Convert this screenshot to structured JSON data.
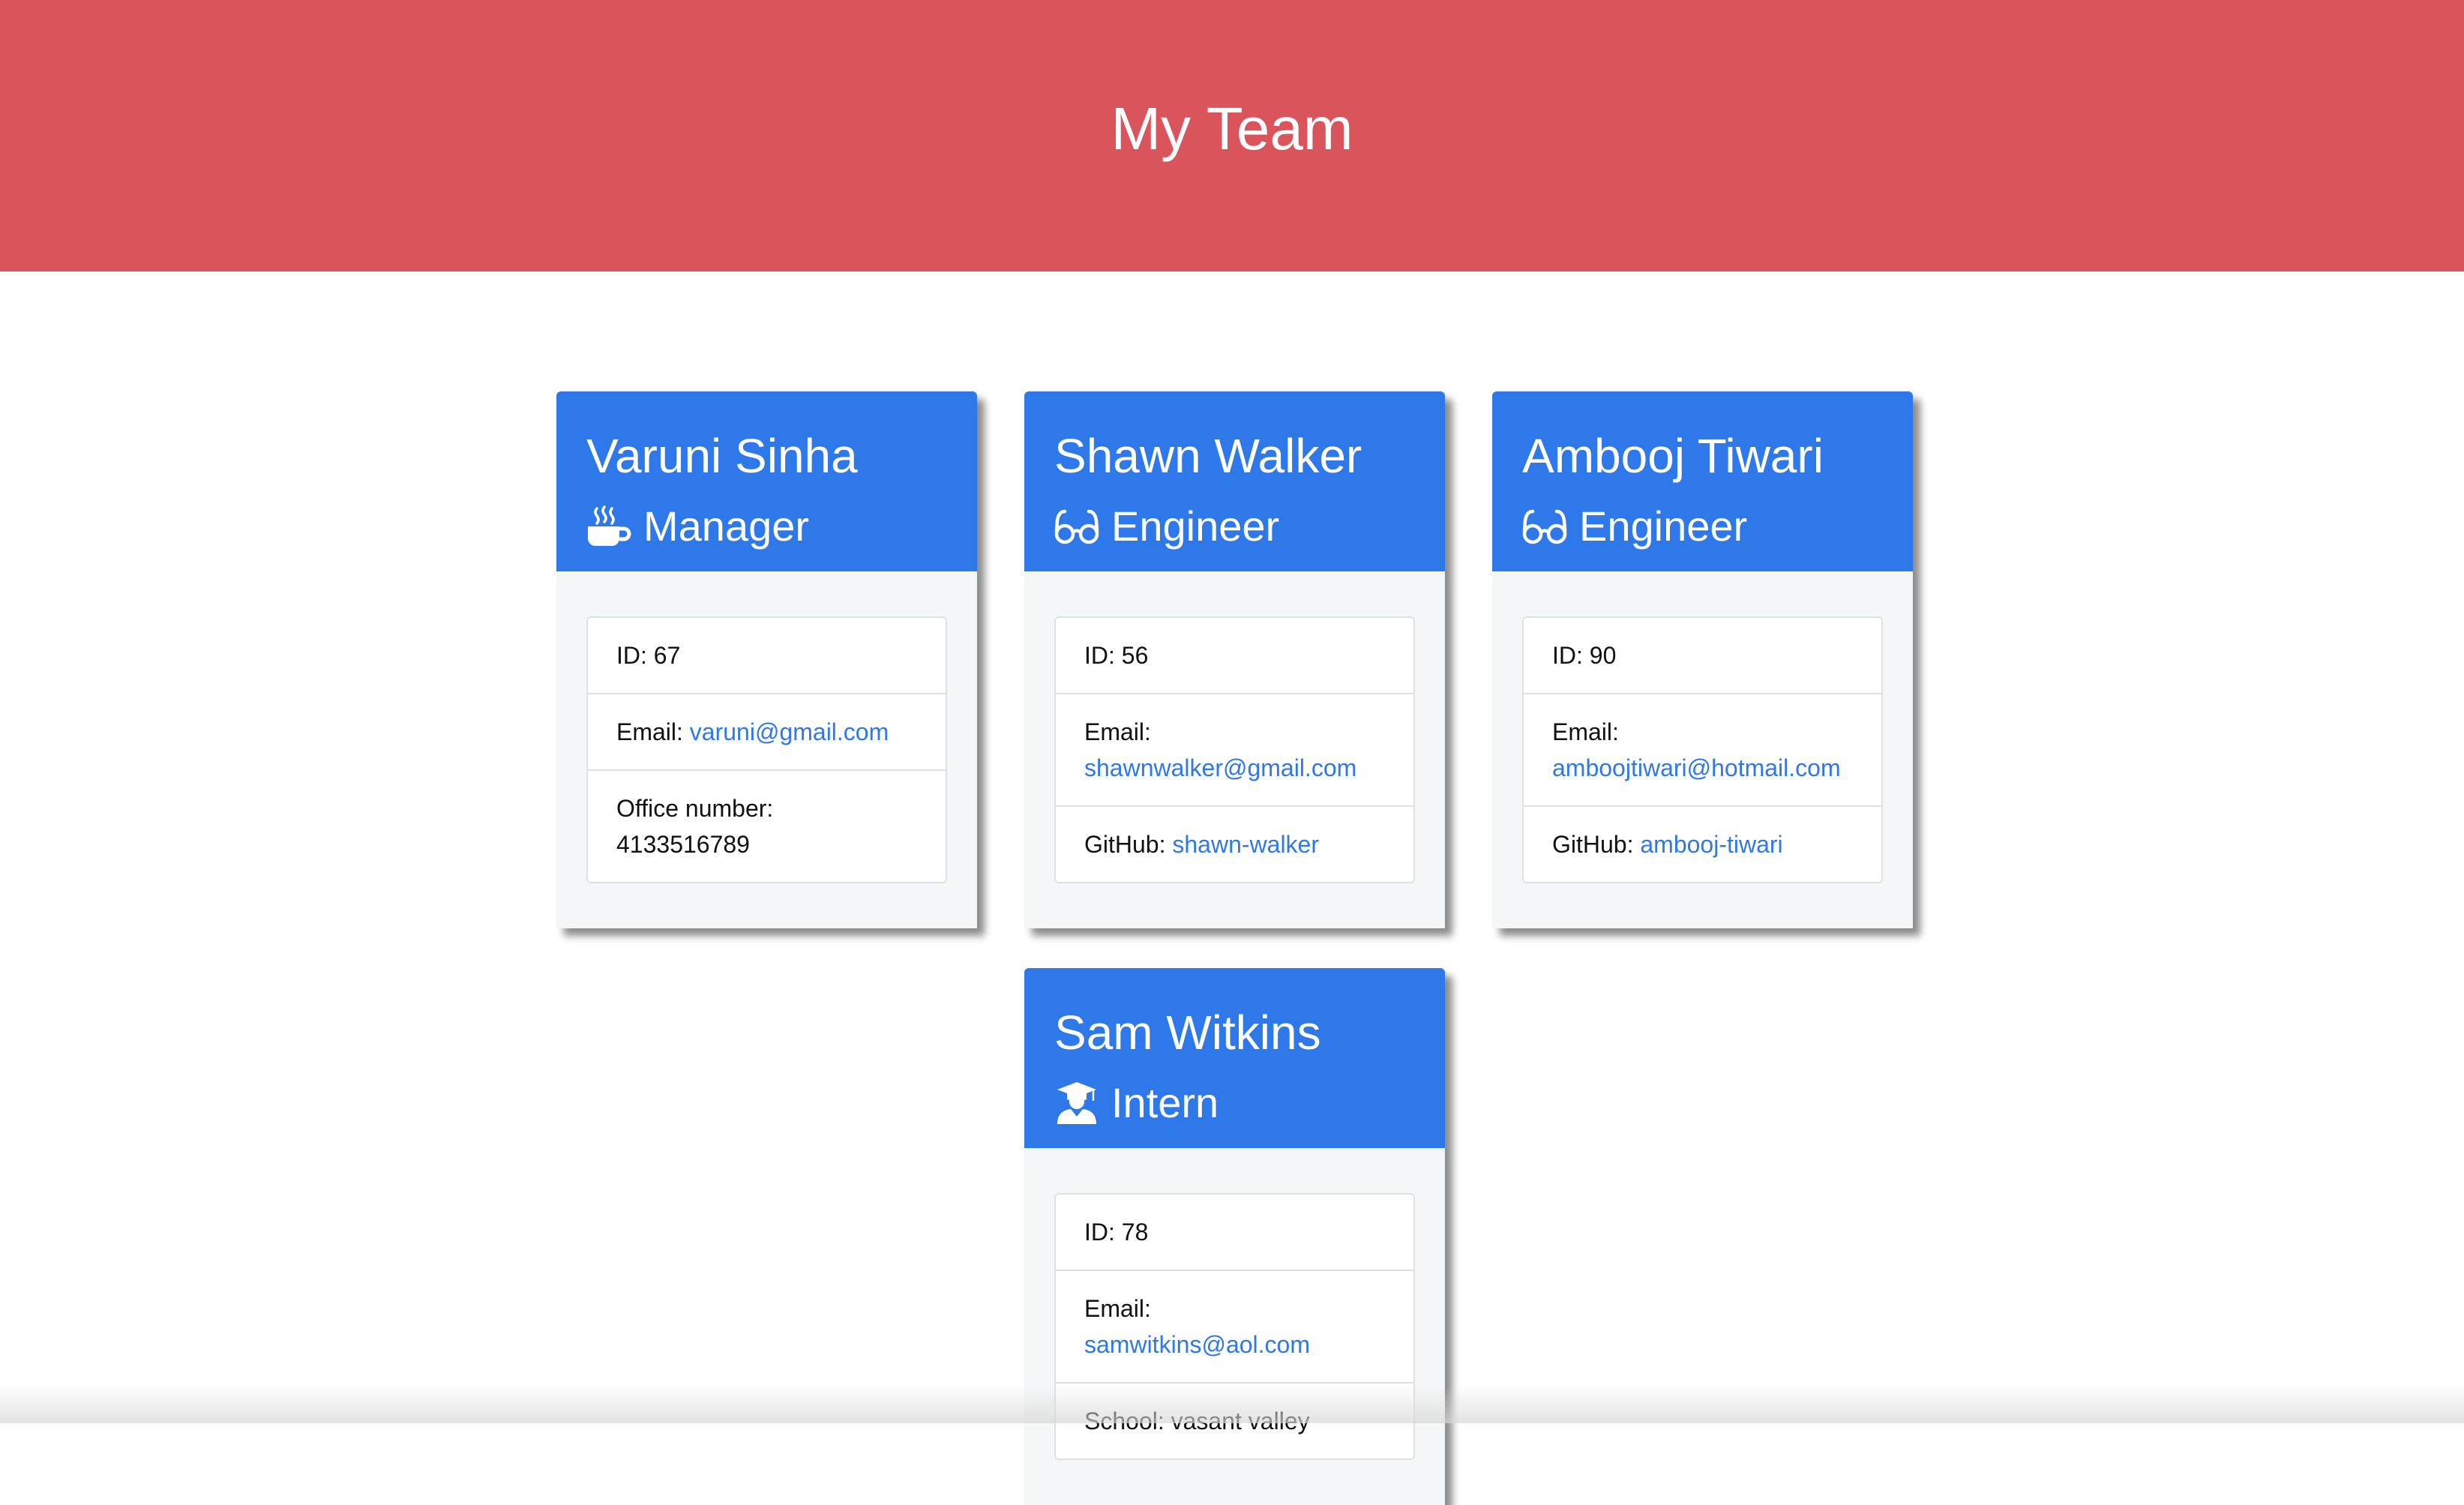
{
  "header": {
    "title": "My Team",
    "background_color": "#d9545b"
  },
  "theme": {
    "card_header_color": "#2f78ea",
    "link_color": "#2f78ea"
  },
  "team": [
    {
      "name": "Varuni Sinha",
      "role": "Manager",
      "icon": "coffee-mug-icon",
      "id_label": "ID: 67",
      "email_label": "Email:",
      "email": "varuni@gmail.com",
      "extra_label": "Office number:",
      "extra_value": "4133516789"
    },
    {
      "name": "Shawn Walker",
      "role": "Engineer",
      "icon": "glasses-icon",
      "id_label": "ID: 56",
      "email_label": "Email:",
      "email": "shawnwalker@gmail.com",
      "extra_label": "GitHub:",
      "extra_value": "shawn-walker"
    },
    {
      "name": "Ambooj Tiwari",
      "role": "Engineer",
      "icon": "glasses-icon",
      "id_label": "ID: 90",
      "email_label": "Email:",
      "email": "amboojtiwari@hotmail.com",
      "extra_label": "GitHub:",
      "extra_value": "ambooj-tiwari"
    },
    {
      "name": "Sam Witkins",
      "role": "Intern",
      "icon": "graduate-icon",
      "id_label": "ID: 78",
      "email_label": "Email:",
      "email": "samwitkins@aol.com",
      "extra_label": "School:",
      "extra_value": "vasant valley"
    }
  ]
}
